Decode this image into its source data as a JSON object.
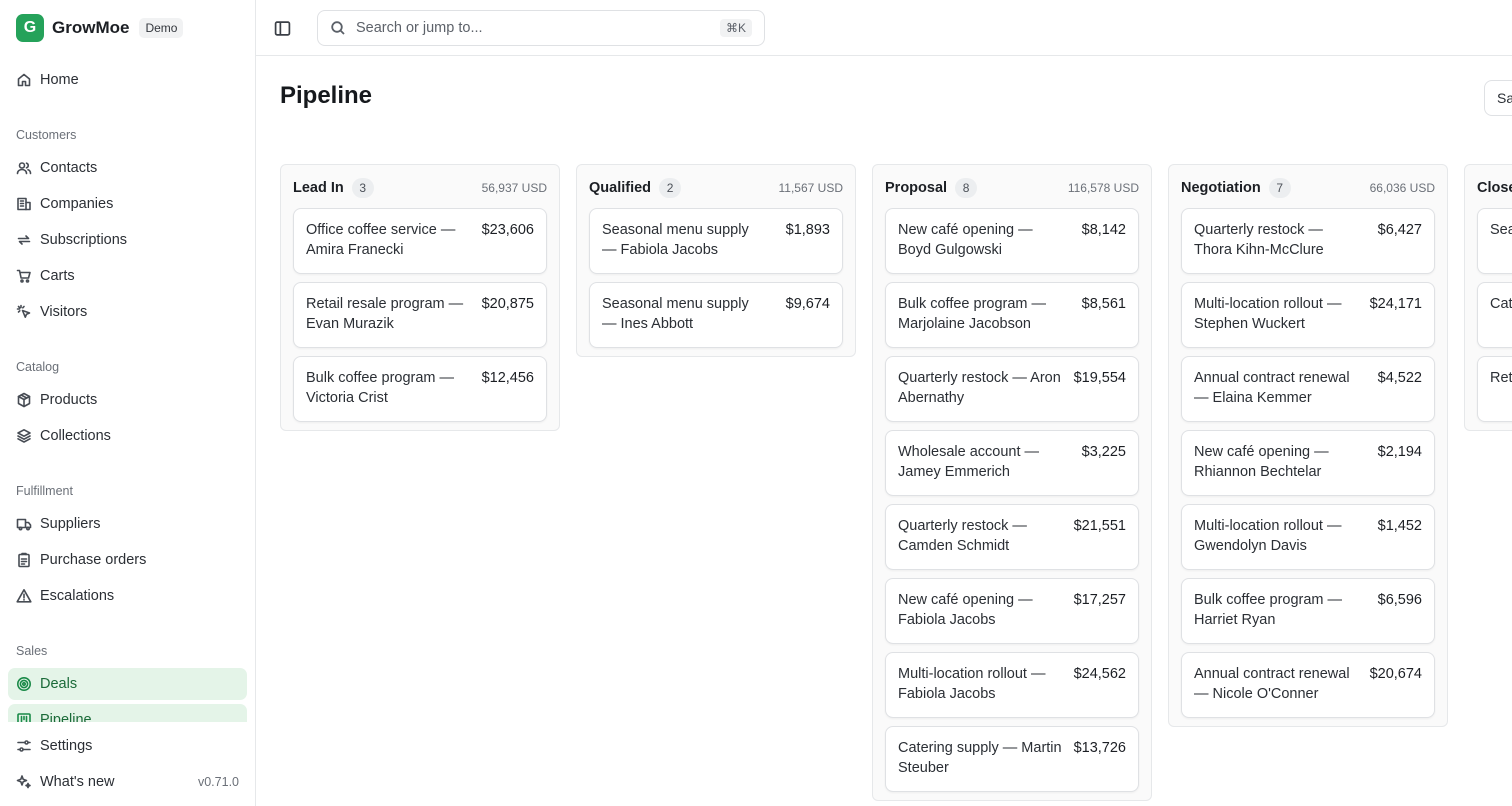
{
  "brand": {
    "logo_letter": "G",
    "name": "GrowMoe",
    "badge": "Demo",
    "color": "#25a25a"
  },
  "sidebar": {
    "home": "Home",
    "sections": {
      "customers": "Customers",
      "catalog": "Catalog",
      "fulfillment": "Fulfillment",
      "sales": "Sales"
    },
    "customers_items": [
      "Contacts",
      "Companies",
      "Subscriptions",
      "Carts",
      "Visitors"
    ],
    "catalog_items": [
      "Products",
      "Collections"
    ],
    "fulfillment_items": [
      "Suppliers",
      "Purchase orders",
      "Escalations"
    ],
    "sales_items": [
      "Deals",
      "Pipeline"
    ],
    "settings": "Settings",
    "whats_new": "What's new",
    "version": "v0.71.0"
  },
  "topbar": {
    "search_placeholder": "Search or jump to...",
    "shortcut": "⌘K"
  },
  "page": {
    "title": "Pipeline",
    "right_button": "Sa"
  },
  "columns": [
    {
      "name": "Lead In",
      "count": "3",
      "total": "56,937 USD",
      "cards": [
        {
          "title": "Office coffee service — Amira Franecki",
          "amount": "$23,606"
        },
        {
          "title": "Retail resale program — Evan Murazik",
          "amount": "$20,875"
        },
        {
          "title": "Bulk coffee program — Victoria Crist",
          "amount": "$12,456"
        }
      ]
    },
    {
      "name": "Qualified",
      "count": "2",
      "total": "11,567 USD",
      "cards": [
        {
          "title": "Seasonal menu supply — Fabiola Jacobs",
          "amount": "$1,893"
        },
        {
          "title": "Seasonal menu supply — Ines Abbott",
          "amount": "$9,674"
        }
      ]
    },
    {
      "name": "Proposal",
      "count": "8",
      "total": "116,578 USD",
      "cards": [
        {
          "title": "New café opening — Boyd Gulgowski",
          "amount": "$8,142"
        },
        {
          "title": "Bulk coffee program — Marjolaine Jacobson",
          "amount": "$8,561"
        },
        {
          "title": "Quarterly restock — Aron Abernathy",
          "amount": "$19,554"
        },
        {
          "title": "Wholesale account — Jamey Emmerich",
          "amount": "$3,225"
        },
        {
          "title": "Quarterly restock — Camden Schmidt",
          "amount": "$21,551"
        },
        {
          "title": "New café opening — Fabiola Jacobs",
          "amount": "$17,257"
        },
        {
          "title": "Multi-location rollout — Fabiola Jacobs",
          "amount": "$24,562"
        },
        {
          "title": "Catering supply — Martin Steuber",
          "amount": "$13,726"
        }
      ]
    },
    {
      "name": "Negotiation",
      "count": "7",
      "total": "66,036 USD",
      "cards": [
        {
          "title": "Quarterly restock — Thora Kihn-McClure",
          "amount": "$6,427"
        },
        {
          "title": "Multi-location rollout — Stephen Wuckert",
          "amount": "$24,171"
        },
        {
          "title": "Annual contract renewal — Elaina Kemmer",
          "amount": "$4,522"
        },
        {
          "title": "New café opening — Rhiannon Bechtelar",
          "amount": "$2,194"
        },
        {
          "title": "Multi-location rollout — Gwendolyn Davis",
          "amount": "$1,452"
        },
        {
          "title": "Bulk coffee program — Harriet Ryan",
          "amount": "$6,596"
        },
        {
          "title": "Annual contract renewal — Nicole O'Conner",
          "amount": "$20,674"
        }
      ]
    },
    {
      "name": "Close",
      "cards": [
        {
          "title": "Sea Gw",
          "amount": ""
        },
        {
          "title": "Cat Abe",
          "amount": ""
        },
        {
          "title": "Ret Ber",
          "amount": ""
        }
      ]
    }
  ]
}
